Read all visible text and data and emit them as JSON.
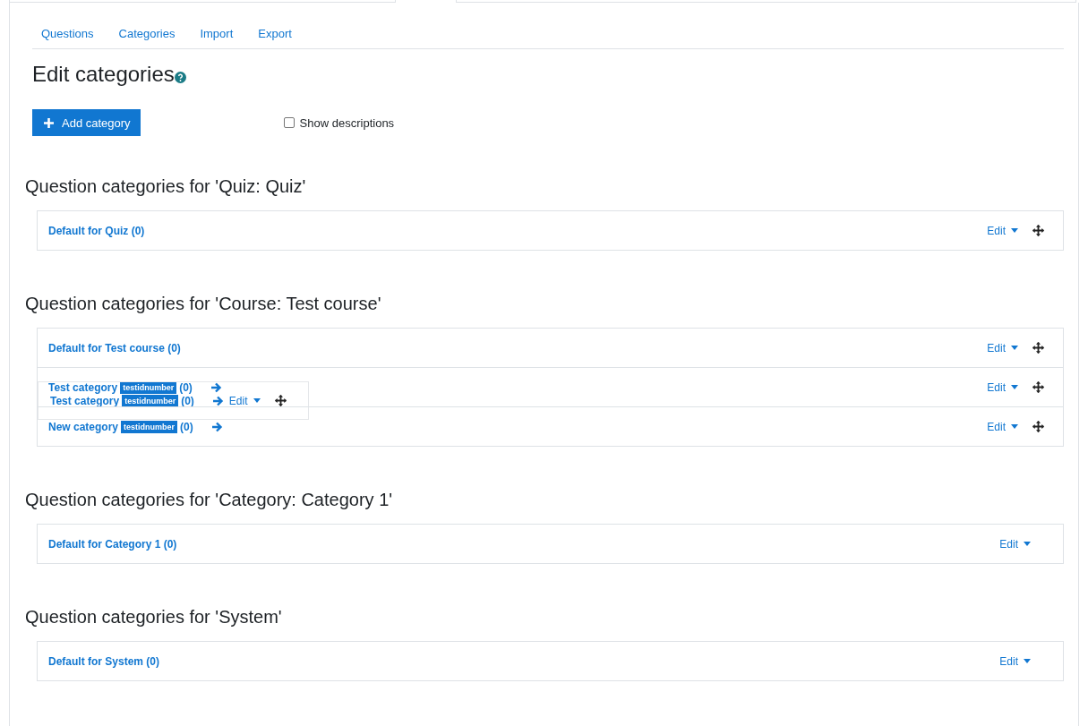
{
  "nav_tabs": [
    {
      "label": "Questions"
    },
    {
      "label": "Categories"
    },
    {
      "label": "Import"
    },
    {
      "label": "Export"
    }
  ],
  "title": "Edit categories",
  "add_button": "Add category",
  "show_descriptions": {
    "label": "Show descriptions",
    "checked": false
  },
  "sections": [
    {
      "heading": "Question categories for 'Quiz: Quiz'",
      "categories": [
        {
          "name": "Default for Quiz",
          "count": "(0)",
          "arrow": false,
          "edit": "Edit",
          "movable": true
        }
      ]
    },
    {
      "heading": "Question categories for 'Course: Test course'",
      "categories": [
        {
          "name": "Default for Test course",
          "count": "(0)",
          "arrow": false,
          "edit": "Edit",
          "movable": true
        },
        {
          "name": "Test category",
          "idnumber": "testidnumber",
          "count": "(0)",
          "arrow": true,
          "edit": "Edit",
          "movable": true,
          "drag_ghost": {
            "name": "Test category",
            "idnumber": "testidnumber",
            "count": "(0)",
            "edit": "Edit"
          }
        },
        {
          "name": "New category",
          "idnumber": "testidnumber",
          "count": "(0)",
          "arrow": true,
          "edit": "Edit",
          "movable": true
        }
      ]
    },
    {
      "heading": "Question categories for 'Category: Category 1'",
      "categories": [
        {
          "name": "Default for Category 1",
          "count": "(0)",
          "arrow": false,
          "edit": "Edit",
          "movable": false
        }
      ]
    },
    {
      "heading": "Question categories for 'System'",
      "categories": [
        {
          "name": "Default for System",
          "count": "(0)",
          "arrow": false,
          "edit": "Edit",
          "movable": false
        }
      ]
    }
  ]
}
